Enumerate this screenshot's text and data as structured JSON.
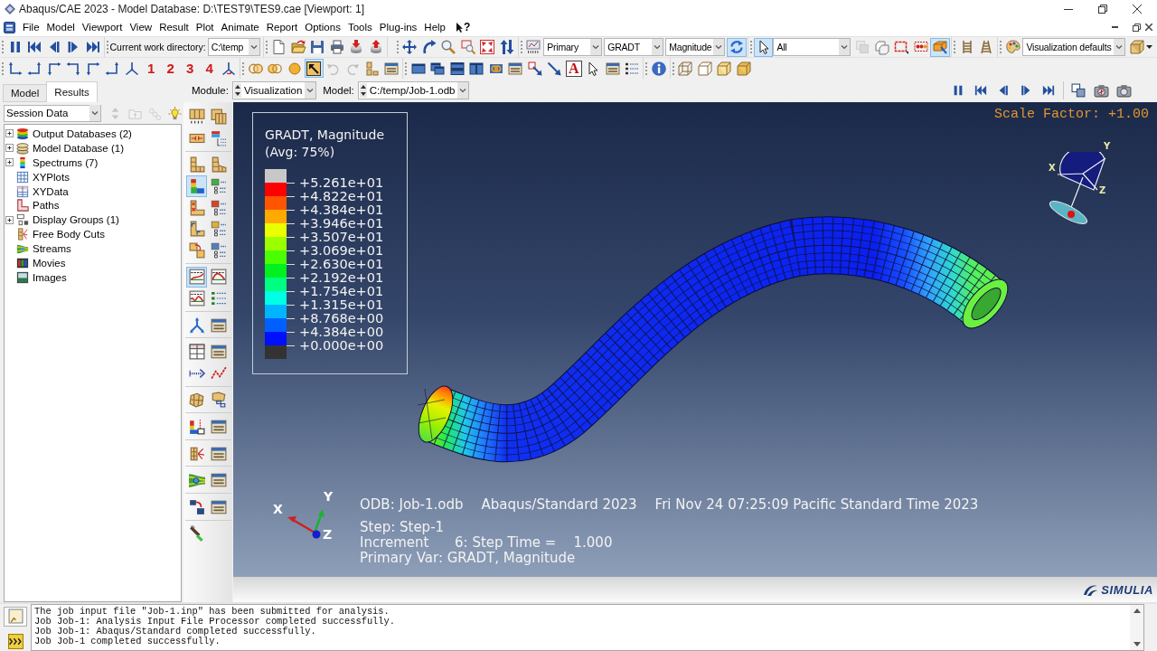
{
  "title_bar": {
    "title": "Abaqus/CAE 2023 - Model Database: D:\\TEST9\\TES9.cae [Viewport: 1]"
  },
  "menu_bar": {
    "items": [
      "File",
      "Model",
      "Viewport",
      "View",
      "Result",
      "Plot",
      "Animate",
      "Report",
      "Options",
      "Tools",
      "Plug-ins",
      "Help"
    ],
    "help_pointer": "?"
  },
  "toolbar_rows": [
    [
      [
        {
          "kind": "pause",
          "selected": false,
          "disabled": false
        },
        {
          "kind": "first",
          "selected": false,
          "disabled": false
        },
        {
          "kind": "prev",
          "selected": false,
          "disabled": false
        },
        {
          "kind": "next",
          "selected": false,
          "disabled": false
        },
        {
          "kind": "last",
          "selected": false,
          "disabled": false
        }
      ],
      [
        {
          "kind": "label",
          "text": "Current work directory:"
        },
        {
          "kind": "combo",
          "value": "C:\\temp"
        }
      ],
      [
        {
          "kind": "new",
          "selected": false,
          "disabled": false
        },
        {
          "kind": "open",
          "selected": false,
          "disabled": false
        },
        {
          "kind": "save",
          "selected": false,
          "disabled": false
        },
        {
          "kind": "print",
          "selected": false,
          "disabled": false
        },
        {
          "kind": "db_down",
          "selected": false,
          "disabled": false
        },
        {
          "kind": "db_up",
          "selected": false,
          "disabled": false
        }
      ],
      [
        {
          "kind": "pan",
          "selected": false,
          "disabled": false
        },
        {
          "kind": "rotate",
          "selected": false,
          "disabled": false
        },
        {
          "kind": "zoom",
          "selected": false,
          "disabled": false
        },
        {
          "kind": "box_zoom",
          "selected": false,
          "disabled": false
        },
        {
          "kind": "fit",
          "selected": false,
          "disabled": false
        },
        {
          "kind": "flip",
          "selected": false,
          "disabled": false
        }
      ],
      [
        {
          "kind": "step_select",
          "selected": false,
          "disabled": false
        },
        {
          "kind": "combo",
          "value": "Primary"
        },
        {
          "kind": "combo",
          "value": "GRADT"
        },
        {
          "kind": "combo",
          "value": "Magnitude"
        },
        {
          "kind": "sync",
          "selected": true,
          "disabled": false
        }
      ],
      [
        {
          "kind": "pointer",
          "selected": true,
          "disabled": false
        },
        {
          "kind": "combo",
          "value": "All"
        },
        {
          "kind": "gray_squares",
          "selected": false,
          "disabled": true
        },
        {
          "kind": "cubes_outline",
          "selected": false,
          "disabled": false
        },
        {
          "kind": "red_box",
          "selected": false,
          "disabled": false
        },
        {
          "kind": "red_dots",
          "selected": false,
          "disabled": false
        },
        {
          "kind": "orange_box",
          "selected": true,
          "disabled": false
        }
      ],
      [
        {
          "kind": "ladder",
          "selected": false,
          "disabled": false
        },
        {
          "kind": "rails",
          "selected": false,
          "disabled": false
        }
      ],
      [
        {
          "kind": "palette",
          "selected": false,
          "disabled": false
        },
        {
          "kind": "combo",
          "value": "Visualization defaults"
        },
        {
          "kind": "cube_menu",
          "selected": false,
          "disabled": false
        }
      ]
    ],
    [
      [
        {
          "kind": "axis_1",
          "selected": false,
          "disabled": false
        },
        {
          "kind": "axis_2",
          "selected": false,
          "disabled": false
        },
        {
          "kind": "axis_3",
          "selected": false,
          "disabled": false
        },
        {
          "kind": "axis_4",
          "selected": false,
          "disabled": false
        },
        {
          "kind": "axis_5",
          "selected": false,
          "disabled": false
        },
        {
          "kind": "axis_6",
          "selected": false,
          "disabled": false
        },
        {
          "kind": "iso_triad",
          "selected": false,
          "disabled": false
        },
        {
          "kind": "number",
          "label": "1",
          "selected": false,
          "disabled": false
        },
        {
          "kind": "number",
          "label": "2",
          "selected": false,
          "disabled": false
        },
        {
          "kind": "number",
          "label": "3",
          "selected": false,
          "disabled": false
        },
        {
          "kind": "number",
          "label": "4",
          "selected": false,
          "disabled": false
        },
        {
          "kind": "rotate_triad",
          "selected": false,
          "disabled": false
        }
      ],
      [
        {
          "kind": "overlap_circles",
          "selected": false,
          "disabled": false
        },
        {
          "kind": "two_circles",
          "selected": false,
          "disabled": false
        },
        {
          "kind": "sphere",
          "selected": false,
          "disabled": false
        },
        {
          "kind": "pick_box",
          "selected": true,
          "disabled": false
        },
        {
          "kind": "undo",
          "selected": false,
          "disabled": true
        },
        {
          "kind": "redo",
          "selected": false,
          "disabled": true
        },
        {
          "kind": "blocks",
          "selected": false,
          "disabled": false
        },
        {
          "kind": "window_list",
          "selected": false,
          "disabled": false
        }
      ],
      [
        {
          "kind": "single_window",
          "selected": false,
          "disabled": false
        },
        {
          "kind": "cascade_windows",
          "selected": false,
          "disabled": false
        },
        {
          "kind": "stacked_windows",
          "selected": false,
          "disabled": false
        },
        {
          "kind": "side_windows",
          "selected": false,
          "disabled": false
        },
        {
          "kind": "link_rings",
          "selected": false,
          "disabled": false
        },
        {
          "kind": "window_list",
          "selected": false,
          "disabled": false
        },
        {
          "kind": "annot_arrow",
          "selected": false,
          "disabled": false
        },
        {
          "kind": "diag_arrow",
          "selected": false,
          "disabled": false
        },
        {
          "kind": "letter",
          "label": "A",
          "selected": false,
          "disabled": false
        },
        {
          "kind": "pointer",
          "selected": false,
          "disabled": false
        },
        {
          "kind": "window_list",
          "selected": false,
          "disabled": false
        },
        {
          "kind": "list",
          "selected": false,
          "disabled": false
        }
      ],
      [
        {
          "kind": "info",
          "selected": false,
          "disabled": false
        }
      ],
      [
        {
          "kind": "cube_wire",
          "selected": false,
          "disabled": false
        },
        {
          "kind": "cube_outline",
          "selected": false,
          "disabled": false
        },
        {
          "kind": "cube_shaded",
          "selected": false,
          "disabled": false
        },
        {
          "kind": "cube_solid",
          "selected": false,
          "disabled": false
        }
      ]
    ]
  ],
  "context_bar": {
    "tabs": [
      {
        "label": "Model",
        "selected": false
      },
      {
        "label": "Results",
        "selected": true
      }
    ],
    "module_label": "Module:",
    "module": "Visualization",
    "model_label": "Model:",
    "model": "C:/temp/Job-1.odb",
    "animation": [
      [
        {
          "kind": "pause",
          "selected": false,
          "disabled": false
        },
        {
          "kind": "first",
          "selected": false,
          "disabled": false
        },
        {
          "kind": "prev",
          "selected": false,
          "disabled": false
        },
        {
          "kind": "next",
          "selected": false,
          "disabled": false
        },
        {
          "kind": "last",
          "selected": false,
          "disabled": false
        }
      ],
      [
        {
          "kind": "copy_window",
          "selected": false,
          "disabled": false
        },
        {
          "kind": "camera",
          "selected": false,
          "disabled": false
        },
        {
          "kind": "camera_movie",
          "selected": false,
          "disabled": false
        }
      ]
    ]
  },
  "session_panel": {
    "source": "Session Data",
    "tools": [
      {
        "kind": "up_down",
        "selected": false,
        "disabled": true
      },
      {
        "kind": "folder_up",
        "selected": false,
        "disabled": true
      },
      {
        "kind": "chain",
        "selected": false,
        "disabled": true
      },
      {
        "kind": "bulb",
        "selected": false,
        "disabled": false
      }
    ],
    "tree": [
      {
        "label": "Output Databases (2)",
        "kind": "odb",
        "expanded": false
      },
      {
        "label": "Model Database (1)",
        "kind": "mdb",
        "expanded": false
      },
      {
        "label": "Spectrums (7)",
        "kind": "spectrum",
        "expanded": false
      },
      {
        "label": "XYPlots",
        "kind": "xyplot"
      },
      {
        "label": "XYData",
        "kind": "xydata"
      },
      {
        "label": "Paths",
        "kind": "path"
      },
      {
        "label": "Display Groups (1)",
        "kind": "group",
        "expanded": false
      },
      {
        "label": "Free Body Cuts",
        "kind": "cut"
      },
      {
        "label": "Streams",
        "kind": "stream"
      },
      {
        "label": "Movies",
        "kind": "movie"
      },
      {
        "label": "Images",
        "kind": "image"
      }
    ]
  },
  "toolbox": [
    [
      {
        "kind": "tb_numbered",
        "selected": false
      },
      {
        "kind": "tb_cards",
        "selected": false
      },
      {
        "kind": "tb_strip",
        "selected": false
      },
      {
        "kind": "tb_layers",
        "selected": false
      }
    ],
    [
      {
        "kind": "tb_mesh",
        "selected": false
      },
      {
        "kind": "tb_mesh_deformed",
        "selected": false
      },
      {
        "kind": "tb_contour",
        "selected": true
      },
      {
        "kind": "tb_opts_contour",
        "selected": false
      },
      {
        "kind": "tb_symbol",
        "selected": false
      },
      {
        "kind": "tb_opts_symbol",
        "selected": false
      },
      {
        "kind": "tb_orient",
        "selected": false
      },
      {
        "kind": "tb_opts_orient",
        "selected": false
      },
      {
        "kind": "tb_ply",
        "selected": false
      },
      {
        "kind": "tb_opts_ply",
        "selected": false
      }
    ],
    [
      {
        "kind": "tb_anim_scale",
        "selected": true
      },
      {
        "kind": "tb_anim_harmonic",
        "selected": false
      },
      {
        "kind": "tb_anim_time",
        "selected": false
      },
      {
        "kind": "tb_opts_anim",
        "selected": false
      }
    ],
    [
      {
        "kind": "tb_triad",
        "selected": false
      },
      {
        "kind": "window_list",
        "selected": false
      }
    ],
    [
      {
        "kind": "tb_xy_table",
        "selected": false
      },
      {
        "kind": "window_list",
        "selected": false
      },
      {
        "kind": "tb_path",
        "selected": false
      },
      {
        "kind": "tb_xy_line",
        "selected": false
      }
    ],
    [
      {
        "kind": "tb_mesh_patch",
        "selected": false
      },
      {
        "kind": "tb_mesh_overlay",
        "selected": false
      }
    ],
    [
      {
        "kind": "tb_cut",
        "selected": false
      },
      {
        "kind": "window_list",
        "selected": false
      }
    ],
    [
      {
        "kind": "tb_fbc",
        "selected": false
      },
      {
        "kind": "window_list",
        "selected": false
      }
    ],
    [
      {
        "kind": "tb_stream",
        "selected": false
      },
      {
        "kind": "window_list",
        "selected": false
      }
    ],
    [
      {
        "kind": "tb_copy",
        "selected": false
      },
      {
        "kind": "window_list",
        "selected": false
      }
    ],
    [
      {
        "kind": "tb_brush",
        "selected": false
      }
    ]
  ],
  "viewport": {
    "scale_factor": "Scale Factor: +1.00",
    "legend": {
      "title": "GRADT, Magnitude",
      "subtitle": "(Avg: 75%)",
      "segments": [
        {
          "color": "#c8c8c8"
        },
        {
          "color": "#ff0000"
        },
        {
          "color": "#ff5500"
        },
        {
          "color": "#ffaa00"
        },
        {
          "color": "#eaff00"
        },
        {
          "color": "#9cff00"
        },
        {
          "color": "#4cff00"
        },
        {
          "color": "#00f020"
        },
        {
          "color": "#00ff80"
        },
        {
          "color": "#00ffe4"
        },
        {
          "color": "#00b4ff"
        },
        {
          "color": "#0060ff"
        },
        {
          "color": "#0010ff"
        },
        {
          "color": "#333333"
        }
      ],
      "labels": [
        "+5.261e+01",
        "+4.822e+01",
        "+4.384e+01",
        "+3.946e+01",
        "+3.507e+01",
        "+3.069e+01",
        "+2.630e+01",
        "+2.192e+01",
        "+1.754e+01",
        "+1.315e+01",
        "+8.768e+00",
        "+4.384e+00",
        "+0.000e+00"
      ]
    },
    "view_triad": [
      "X",
      "Y",
      "Z"
    ],
    "axis_triad": [
      "X",
      "Y",
      "Z"
    ],
    "header": [
      "ODB: Job-1.odb",
      "Abaqus/Standard 2023",
      "Fri Nov 24 07:25:09 Pacific Standard Time 2023"
    ],
    "lines": [
      "Step: Step-1",
      "Increment      6: Step Time =    1.000",
      "Primary Var: GRADT, Magnitude"
    ]
  },
  "brand": {
    "name": "SIMULIA"
  },
  "message_area": {
    "tabs": [
      {
        "kind": "messages",
        "selected": true
      },
      {
        "kind": "python",
        "selected": false
      }
    ],
    "messages": [
      "The job input file \"Job-1.inp\" has been submitted for analysis.",
      "Job Job-1: Analysis Input File Processor completed successfully.",
      "Job Job-1: Abaqus/Standard completed successfully.",
      "Job Job-1 completed successfully."
    ]
  }
}
